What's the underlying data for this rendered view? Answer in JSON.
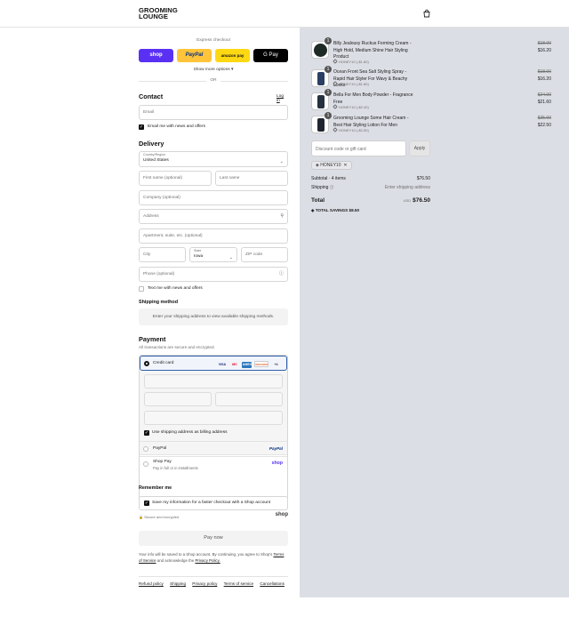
{
  "header": {
    "logo_line1": "GROOMING",
    "logo_line2": "LOUNGE"
  },
  "express": {
    "label": "Express checkout",
    "buttons": [
      {
        "label": "shop",
        "bg": "#5a31f4",
        "fg": "#ffffff"
      },
      {
        "label": "PayPal",
        "bg": "#ffc439",
        "fg": "#003087"
      },
      {
        "label": "amazon pay",
        "bg": "#ffd814",
        "fg": "#111111"
      },
      {
        "label": "G Pay",
        "bg": "#000000",
        "fg": "#ffffff"
      }
    ],
    "show_more": "Show more options",
    "or": "OR"
  },
  "contact": {
    "title": "Contact",
    "login_link": "Log in",
    "email_placeholder": "Email",
    "email_news_label": "Email me with news and offers"
  },
  "delivery": {
    "title": "Delivery",
    "country_label": "Country/Region",
    "country_value": "United States",
    "first_name": "First name (optional)",
    "last_name": "Last name",
    "company": "Company (optional)",
    "address": "Address",
    "apartment": "Apartment, suite, etc. (optional)",
    "city": "City",
    "state_label": "State",
    "state_value": "Iowa",
    "zip": "ZIP code",
    "phone": "Phone (optional)",
    "text_news_label": "Text me with news and offers"
  },
  "shipping": {
    "title": "Shipping method",
    "message": "Enter your shipping address to view available shipping methods."
  },
  "payment": {
    "title": "Payment",
    "subtitle": "All transactions are secure and encrypted.",
    "credit_card": "Credit card",
    "card_brands": [
      "VISA",
      "MC",
      "AMEX",
      "DISCOVER",
      "+4"
    ],
    "billing_label": "Use shipping address as billing address",
    "paypal": "PayPal",
    "paypal_logo": "PayPal",
    "shop_pay": "Shop Pay",
    "shop_pay_sub": "Pay in full or in installments",
    "shop_pay_logo": "shop"
  },
  "remember": {
    "title": "Remember me",
    "label": "Save my information for a faster checkout with a Shop account",
    "secure": "Secure and encrypted",
    "shop_logo": "shop"
  },
  "pay_now": "Pay now",
  "terms": {
    "text": "Your info will be saved to a Shop account. By continuing, you agree to Shop's",
    "terms_link": "Terms of Service",
    "middle": "and acknowledge the",
    "privacy_link": "Privacy Policy."
  },
  "footer_links": [
    "Refund policy",
    "Shipping",
    "Privacy policy",
    "Terms of service",
    "Cancellations"
  ],
  "summary": {
    "items": [
      {
        "qty": "1",
        "name": "Billy Jealousy Ruckus Forming Cream - High Hold, Medium Shine Hair Styling Product",
        "discount": "HONEY10 (-$1.80)",
        "old_price": "$18.00",
        "price": "$16.20"
      },
      {
        "qty": "1",
        "name": "Ocean Front Sea Salt Styling Spray - Rapid Hair Styler For Wavy & Beachy Looks",
        "discount": "HONEY10 (-$1.80)",
        "old_price": "$18.00",
        "price": "$16.20"
      },
      {
        "qty": "1",
        "name": "Bella For Men Body Powder - Fragrance Free",
        "discount": "HONEY10 (-$2.40)",
        "old_price": "$24.00",
        "price": "$21.60"
      },
      {
        "qty": "1",
        "name": "Grooming Lounge Some Hair Cream - Best Hair Styling Lotion For Men",
        "discount": "HONEY10 (-$2.50)",
        "old_price": "$25.00",
        "price": "$22.50"
      }
    ],
    "discount_placeholder": "Discount code or gift card",
    "apply": "Apply",
    "applied_code": "HONEY10",
    "subtotal_label": "Subtotal · 4 items",
    "subtotal_value": "$76.50",
    "shipping_label": "Shipping",
    "shipping_value": "Enter shipping address",
    "total_label": "Total",
    "currency": "USD",
    "total_value": "$76.50",
    "savings_label": "TOTAL SAVINGS",
    "savings_value": "$8.50"
  }
}
